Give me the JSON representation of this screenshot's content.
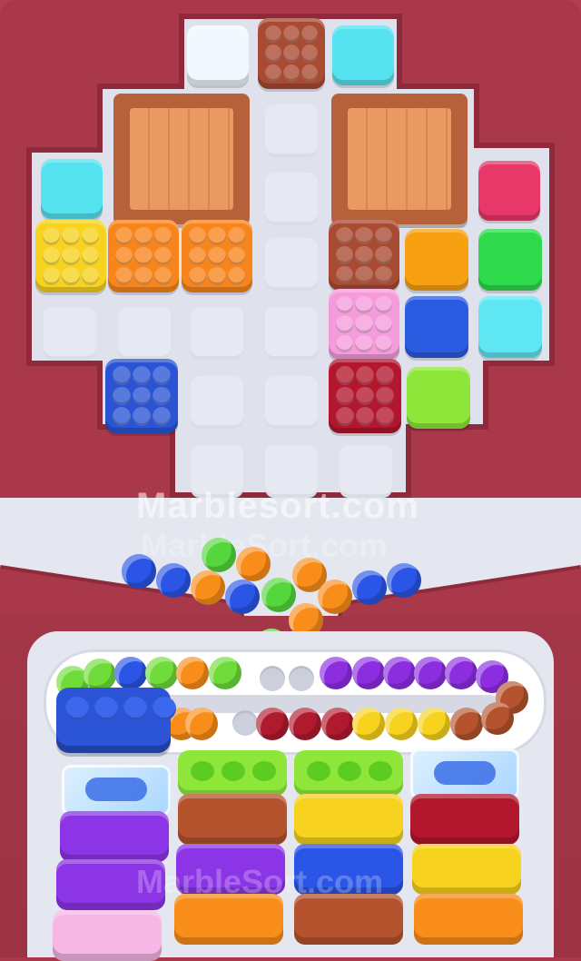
{
  "watermark": {
    "primary": "Marblesort.com",
    "secondary": "MarbleSort.com",
    "tertiary": "MarbleSort.com"
  },
  "colors": {
    "frame": "#a8384a",
    "board": "#dfe2ec",
    "cell": "#e6e9f2",
    "crate": "#b7613a",
    "tray": "#e4e7f0"
  },
  "board": {
    "top_row": [
      "white-tile",
      "brown-bubble-tile",
      "cyan-tile"
    ],
    "crates": [
      "left-crate",
      "right-crate"
    ],
    "tiles": [
      {
        "name": "cyan-tile",
        "color": "#55e3f0"
      },
      {
        "name": "pink-tile",
        "color": "#e8386a"
      },
      {
        "name": "yellow-bubble-tile",
        "color": "#f7d21e"
      },
      {
        "name": "orange-bubble-tile",
        "color": "#f8851b"
      },
      {
        "name": "orange-bubble-tile",
        "color": "#f8851b"
      },
      {
        "name": "brown-bubble-tile",
        "color": "#a94a33"
      },
      {
        "name": "orange-tile",
        "color": "#f7a012"
      },
      {
        "name": "green-tile",
        "color": "#2ed94c"
      },
      {
        "name": "pink-bubble-tile",
        "color": "#f59bdc"
      },
      {
        "name": "blue-tile",
        "color": "#2b5be0"
      },
      {
        "name": "cyan-tile",
        "color": "#5ee6f3"
      },
      {
        "name": "blue-bubble-tile",
        "color": "#2a54d4"
      },
      {
        "name": "crimson-bubble-tile",
        "color": "#b3172d"
      },
      {
        "name": "lime-tile",
        "color": "#8fe63a"
      }
    ]
  },
  "marbles": {
    "funnel": [
      "blue",
      "blue",
      "green",
      "orange",
      "orange",
      "orange",
      "blue",
      "green",
      "orange",
      "orange",
      "blue",
      "blue",
      "orange",
      "green"
    ],
    "track_top": [
      "green",
      "green",
      "blue",
      "green",
      "orange",
      "green",
      "purple",
      "purple",
      "purple",
      "purple",
      "purple",
      "purple",
      "brown"
    ],
    "track_bottom": [
      "orange",
      "orange",
      "crimson",
      "crimson",
      "crimson",
      "yellow",
      "yellow",
      "yellow",
      "brown",
      "brown"
    ]
  },
  "containers": {
    "columns": [
      [
        "ice",
        "purple",
        "purple",
        "pink"
      ],
      [
        "lime-cap",
        "brown",
        "purple",
        "orange"
      ],
      [
        "lime-cap",
        "yellow",
        "blue",
        "brown"
      ],
      [
        "ice",
        "crimson",
        "yellow",
        "orange"
      ]
    ]
  }
}
